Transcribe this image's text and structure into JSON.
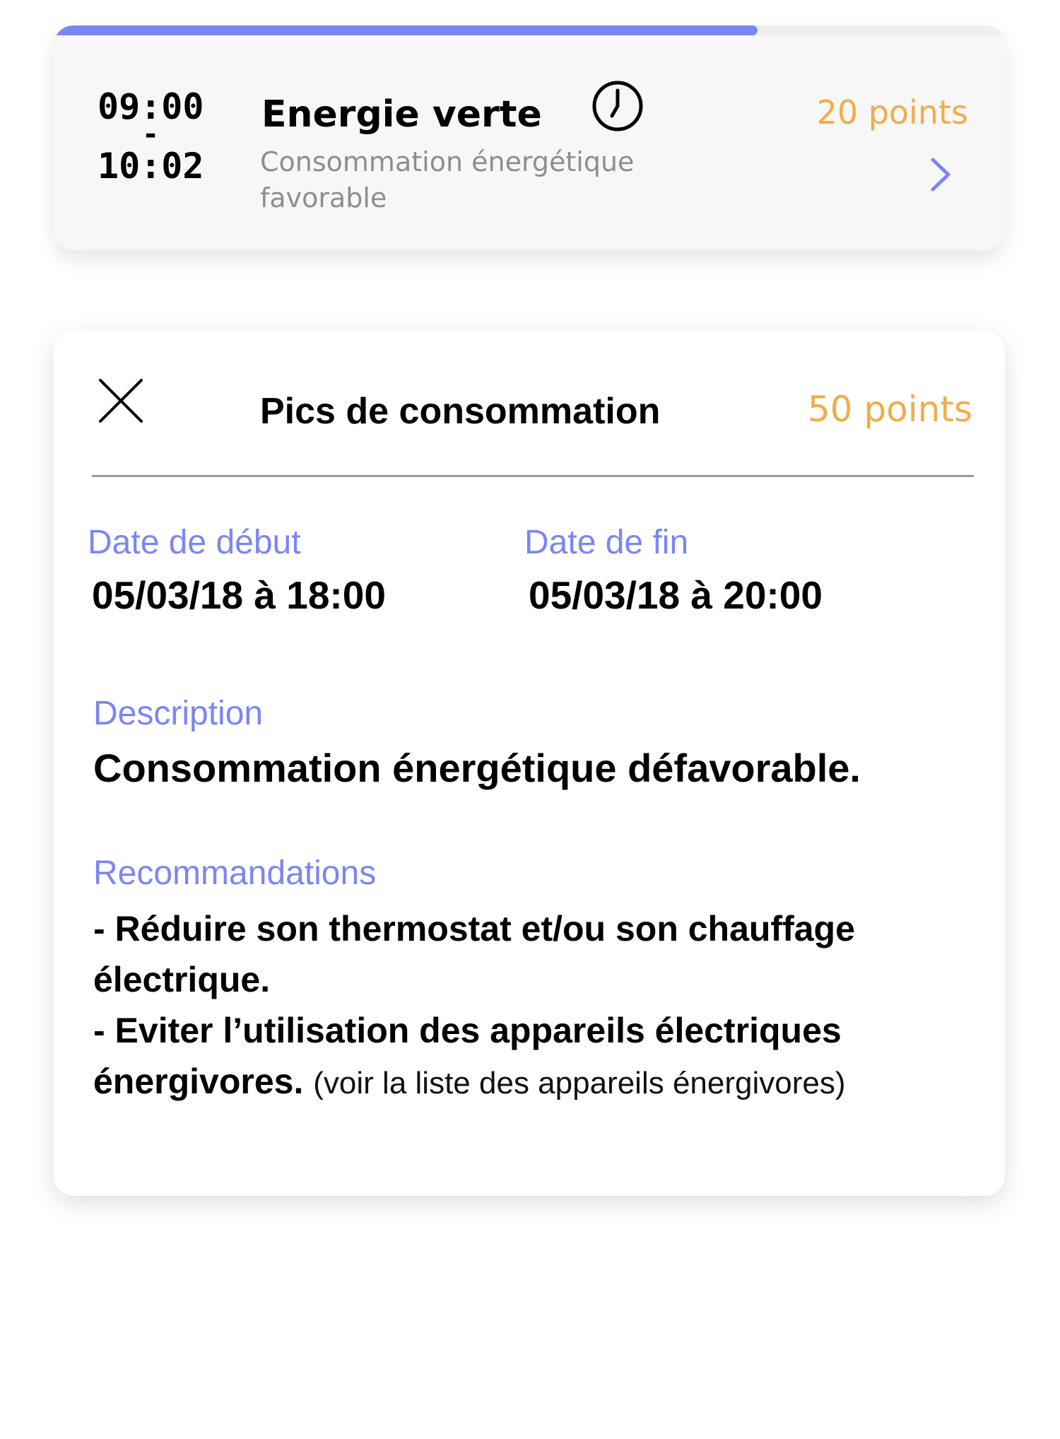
{
  "slot": {
    "progress": 0.74,
    "start_time": "09:00",
    "separator": "-",
    "end_time": "10:02",
    "title": "Energie verte",
    "description": "Consommation énergétique favorable",
    "points": "20 points",
    "icons": {
      "clock": "clock-icon",
      "chevron": "chevron-right-icon"
    }
  },
  "detail": {
    "title": "Pics de consommation",
    "points": "50 points",
    "start_label": "Date de début",
    "start_value": "05/03/18 à 18:00",
    "end_label": "Date de fin",
    "end_value": "05/03/18 à 20:00",
    "description_label": "Description",
    "description_value": "Consommation énergétique défavorable.",
    "recommendations_label": "Recommandations",
    "recommendations": [
      "- Réduire son thermostat et/ou son chauffage",
      "électrique.",
      "- Eviter l’utilisation des appareils électriques",
      "énergivores."
    ],
    "list_link": "(voir la liste des appareils énergivores)",
    "icons": {
      "close": "close-icon"
    }
  },
  "colors": {
    "accent": "#7b86f4",
    "points": "#f2ad46",
    "muted": "#8e8e8e",
    "text": "#000000"
  }
}
